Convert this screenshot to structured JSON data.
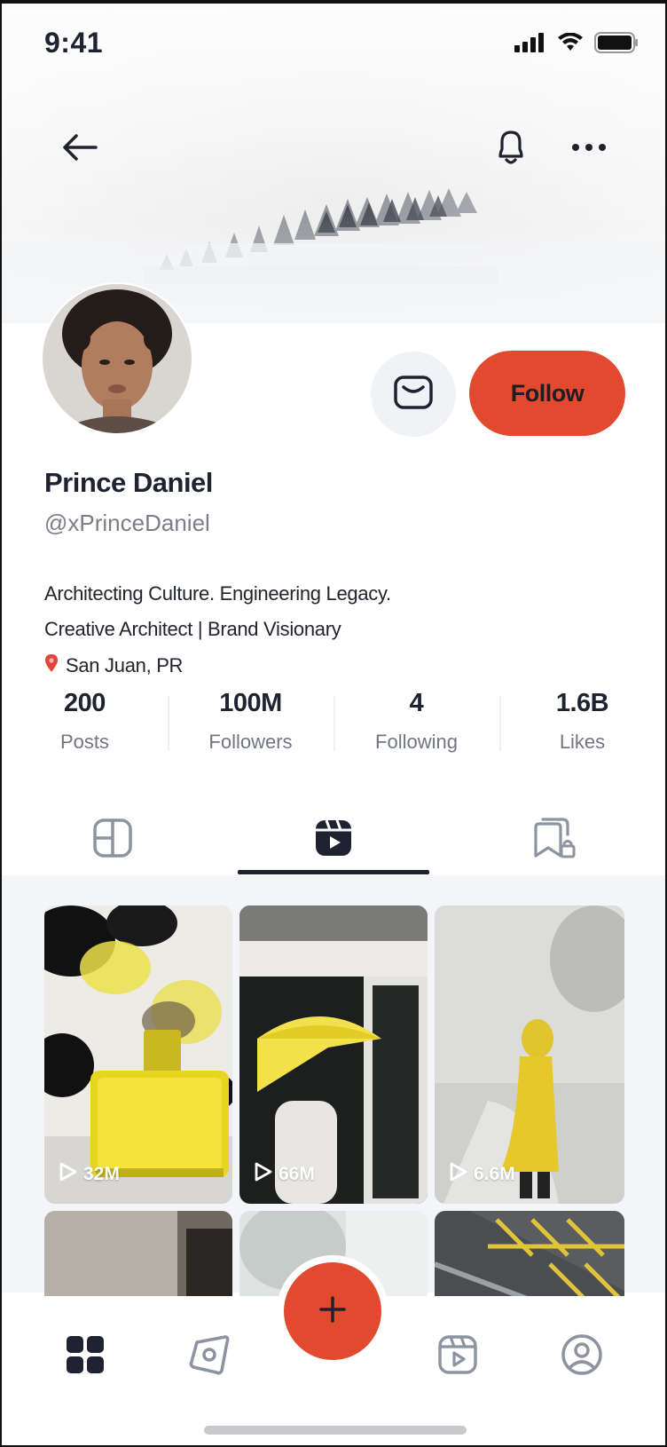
{
  "status_bar": {
    "time": "9:41"
  },
  "profile": {
    "name": "Prince Daniel",
    "handle": "@xPrinceDaniel",
    "bio_line1": "Architecting Culture. Engineering Legacy.",
    "bio_line2": "Creative Architect | Brand Visionary",
    "location": "San Juan, PR",
    "follow_label": "Follow"
  },
  "stats": [
    {
      "value": "200",
      "label": "Posts"
    },
    {
      "value": "100M",
      "label": "Followers"
    },
    {
      "value": "4",
      "label": "Following"
    },
    {
      "value": "1.6B",
      "label": "Likes"
    }
  ],
  "tabs": [
    "grid-icon",
    "reels-icon",
    "saved-locked-icon"
  ],
  "videos": [
    {
      "views": "32M"
    },
    {
      "views": "66M"
    },
    {
      "views": "6.6M"
    }
  ],
  "colors": {
    "accent": "#e14a2e",
    "ink": "#1f2230",
    "muted": "#7b7e8a"
  }
}
